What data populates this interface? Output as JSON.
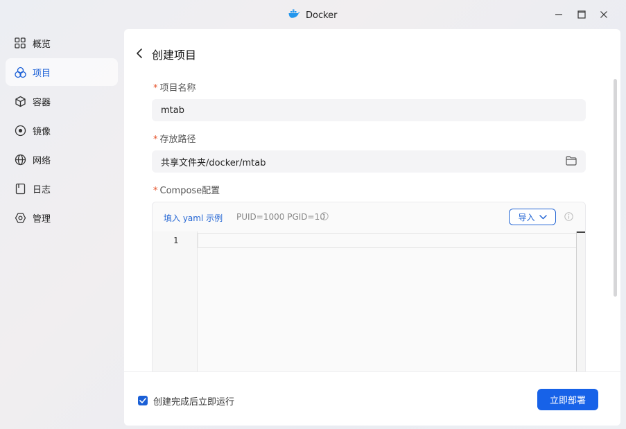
{
  "window": {
    "title": "Docker"
  },
  "sidebar": {
    "items": [
      {
        "label": "概览",
        "icon": "grid-icon",
        "active": false
      },
      {
        "label": "项目",
        "icon": "circles-icon",
        "active": true
      },
      {
        "label": "容器",
        "icon": "cube-icon",
        "active": false
      },
      {
        "label": "镜像",
        "icon": "disc-icon",
        "active": false
      },
      {
        "label": "网络",
        "icon": "globe-icon",
        "active": false
      },
      {
        "label": "日志",
        "icon": "log-icon",
        "active": false
      },
      {
        "label": "管理",
        "icon": "hexagon-gear-icon",
        "active": false
      }
    ]
  },
  "page": {
    "title": "创建项目",
    "name_label": "项目名称",
    "name_value": "mtab",
    "path_label": "存放路径",
    "path_value": "共享文件夹/docker/mtab",
    "compose_label": "Compose配置",
    "required_mark": "*",
    "yaml_link": "填入 yaml 示例",
    "puid_text": "PUID=1000 PGID=10",
    "import_label": "导入",
    "editor_line_number": "1"
  },
  "footer": {
    "checkbox_label": "创建完成后立即运行",
    "checkbox_checked": true,
    "deploy_label": "立即部署"
  },
  "colors": {
    "accent": "#1762e8",
    "required": "#e5532b",
    "active_nav": "#1a5fd6"
  }
}
